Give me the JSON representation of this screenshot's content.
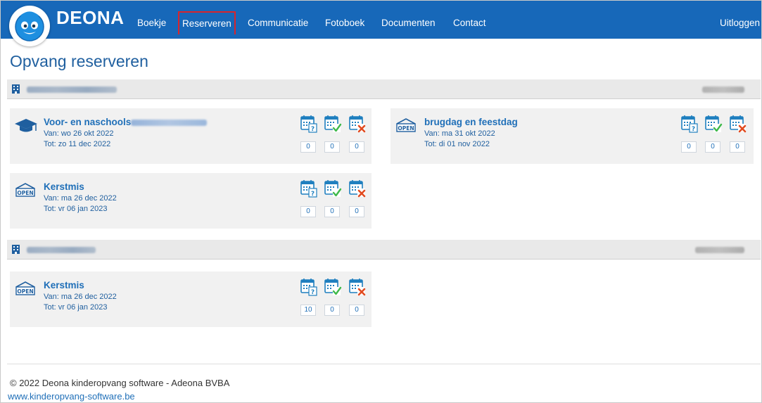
{
  "app": {
    "brand": "DEONA"
  },
  "nav": {
    "items": [
      {
        "label": "Boekje",
        "active": false
      },
      {
        "label": "Reserveren",
        "active": true
      },
      {
        "label": "Communicatie",
        "active": false
      },
      {
        "label": "Fotoboek",
        "active": false
      },
      {
        "label": "Documenten",
        "active": false
      },
      {
        "label": "Contact",
        "active": false
      }
    ],
    "logout": "Uitloggen"
  },
  "page": {
    "title": "Opvang reserveren"
  },
  "colors": {
    "navbar": "#1768b9",
    "link": "#1f6fb8",
    "active_outline": "#d9242b",
    "card_bg": "#f1f1f1"
  },
  "groups": [
    {
      "icon": "building-icon",
      "cards": [
        {
          "icon": "graduation-cap-icon",
          "title": "Voor- en naschools",
          "van": "Van: wo 26 okt 2022",
          "tot": "Tot: zo 11 dec 2022",
          "counts": [
            "0",
            "0",
            "0"
          ]
        },
        {
          "icon": "open-sign-icon",
          "title": "brugdag en feestdag",
          "van": "Van: ma 31 okt 2022",
          "tot": "Tot: di 01 nov 2022",
          "counts": [
            "0",
            "0",
            "0"
          ]
        },
        {
          "icon": "open-sign-icon",
          "title": "Kerstmis",
          "van": "Van: ma 26 dec 2022",
          "tot": "Tot: vr 06 jan 2023",
          "counts": [
            "0",
            "0",
            "0"
          ]
        }
      ]
    },
    {
      "icon": "building-icon",
      "cards": [
        {
          "icon": "open-sign-icon",
          "title": "Kerstmis",
          "van": "Van: ma 26 dec 2022",
          "tot": "Tot: vr 06 jan 2023",
          "counts": [
            "10",
            "0",
            "0"
          ]
        }
      ]
    }
  ],
  "calendar_icons": [
    "calendar-question-icon",
    "calendar-check-icon",
    "calendar-cross-icon"
  ],
  "footer": {
    "copyright": "© 2022 Deona kinderopvang software - Adeona BVBA",
    "website": "www.kinderopvang-software.be"
  }
}
